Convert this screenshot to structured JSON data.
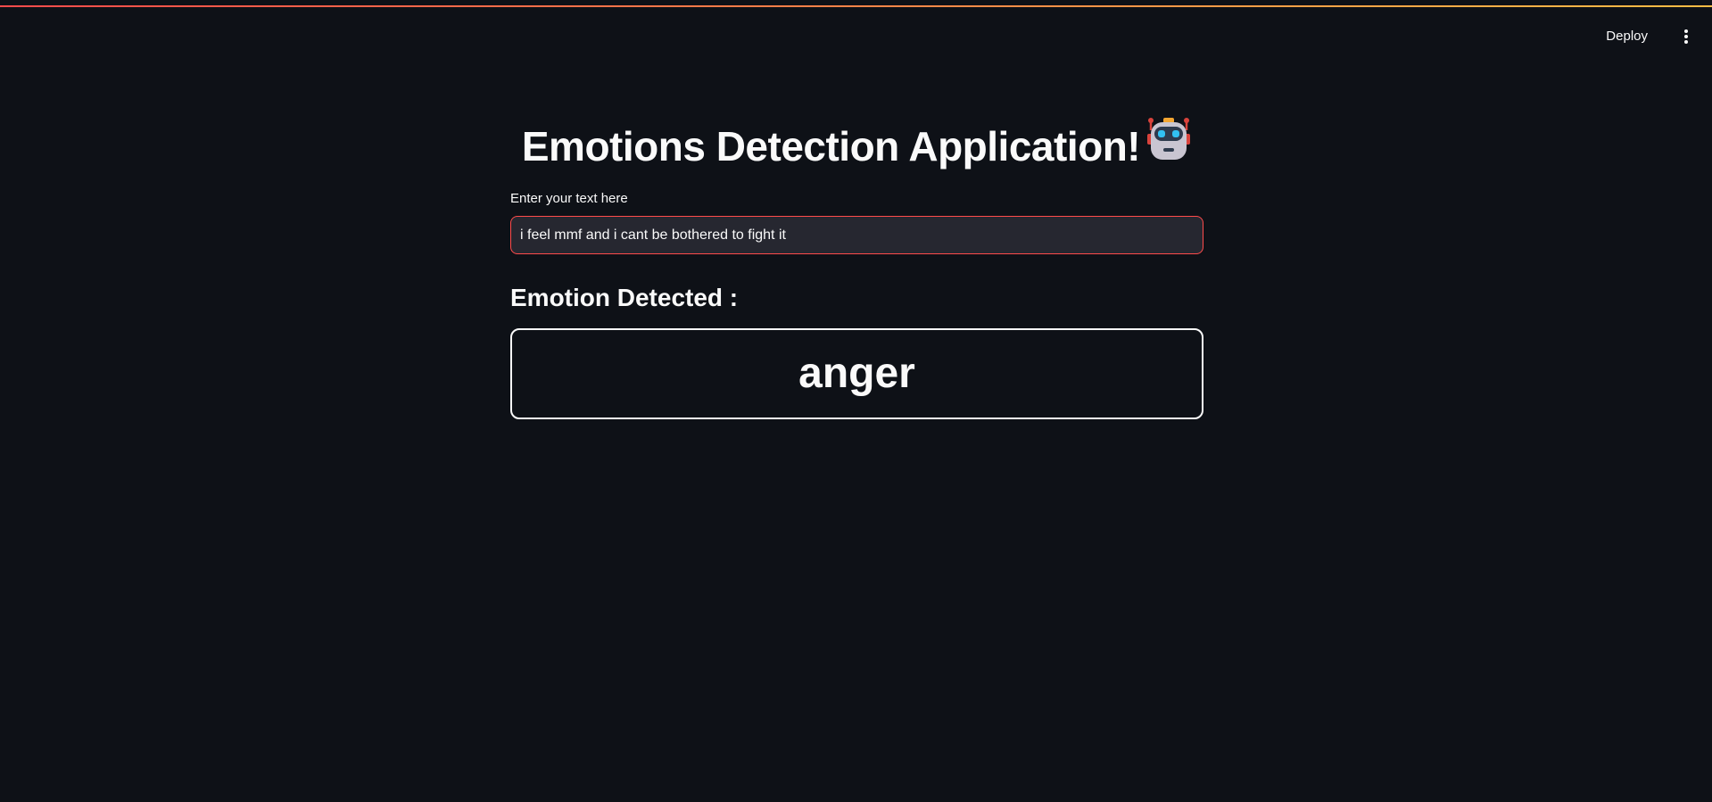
{
  "header": {
    "deploy_label": "Deploy",
    "menu_icon": "kebab-vertical-icon"
  },
  "main": {
    "title": "Emotions Detection Application!",
    "title_icon": "robot-icon",
    "input_label": "Enter your text here",
    "input_value": "i feel mmf and i cant be bothered to fight it",
    "subheader": "Emotion Detected :",
    "result": "anger"
  },
  "colors": {
    "background": "#0e1117",
    "text": "#fafafa",
    "input_background": "#262730",
    "input_focus_border": "#ff4b4b",
    "decoration_start": "#ff4b4b",
    "decoration_end": "#ffbd45"
  }
}
